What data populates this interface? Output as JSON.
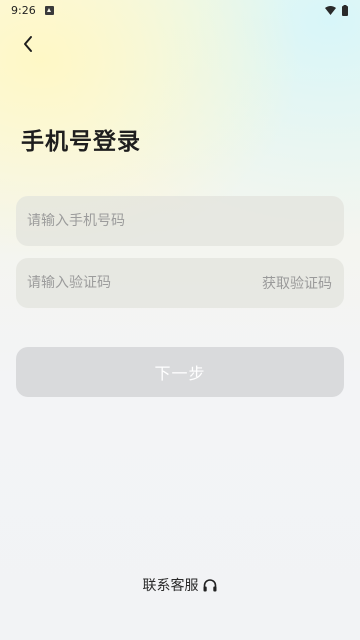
{
  "status_bar": {
    "time": "9:26",
    "notification_icon": "notification-icon",
    "wifi_icon": "wifi-icon",
    "battery_icon": "battery-icon"
  },
  "nav": {
    "back_icon": "chevron-left-icon"
  },
  "login": {
    "title": "手机号登录",
    "phone_placeholder": "请输入手机号码",
    "code_placeholder": "请输入验证码",
    "get_code_label": "获取验证码",
    "next_label": "下一步"
  },
  "footer": {
    "contact_label": "联系客服",
    "contact_icon": "headphones-icon"
  },
  "colors": {
    "title": "#1e1e1e",
    "field_bg": "#e3e4dd",
    "placeholder": "#9c9c9c",
    "next_button_bg": "#d9dadc",
    "next_button_text": "#ffffff"
  }
}
